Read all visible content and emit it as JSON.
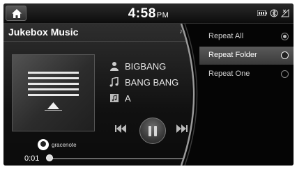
{
  "status_bar": {
    "time": "4:58",
    "ampm": "PM",
    "icons": [
      "battery-icon",
      "bluetooth-icon",
      "signal-icon"
    ]
  },
  "now_playing": {
    "title": "Jukebox Music",
    "artist": "BIGBANG",
    "song": "BANG BANG",
    "album": "A",
    "attribution": "gracenote",
    "elapsed": "0:01"
  },
  "repeat_menu": {
    "items": [
      {
        "label": "Repeat All",
        "state": "checked"
      },
      {
        "label": "Repeat Folder",
        "state": "highlighted"
      },
      {
        "label": "Repeat One",
        "state": "unchecked"
      }
    ]
  }
}
